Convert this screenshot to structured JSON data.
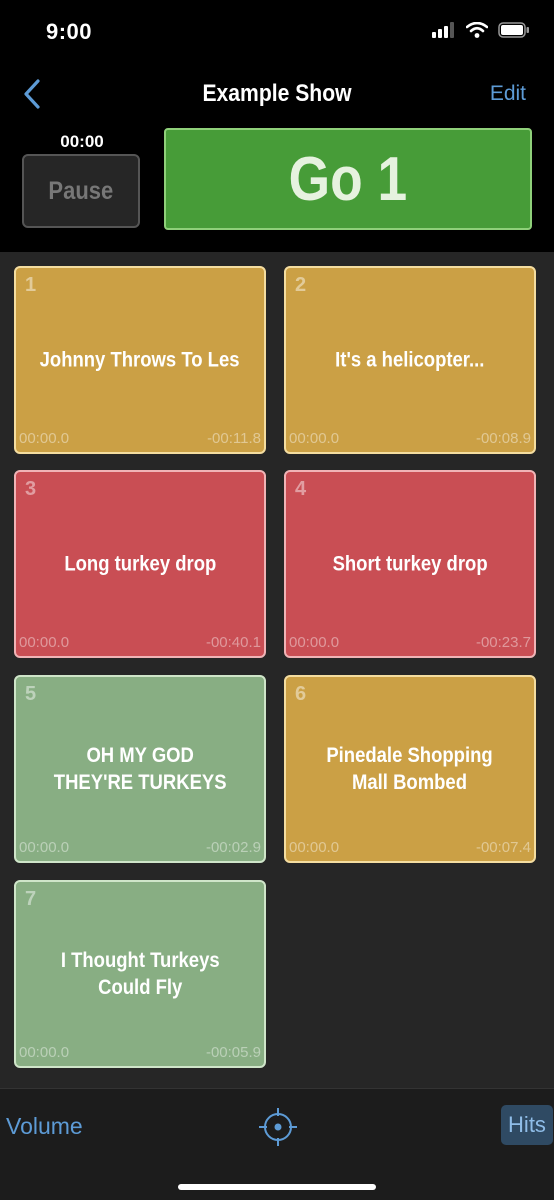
{
  "status_bar": {
    "time": "9:00",
    "icons": [
      "cellular-signal-icon",
      "wifi-icon",
      "battery-icon"
    ]
  },
  "nav": {
    "back_icon": "chevron-left-icon",
    "title": "Example Show",
    "edit_label": "Edit"
  },
  "controls": {
    "timer": "00:00",
    "pause_label": "Pause",
    "go_label": "Go 1"
  },
  "cues": [
    {
      "number": "1",
      "title": "Johnny Throws To Les",
      "elapsed": "00:00.0",
      "remaining": "-00:11.8",
      "color": "#cba045"
    },
    {
      "number": "2",
      "title": "It's a helicopter...",
      "elapsed": "00:00.0",
      "remaining": "-00:08.9",
      "color": "#cba045"
    },
    {
      "number": "3",
      "title": "Long turkey drop",
      "elapsed": "00:00.0",
      "remaining": "-00:40.1",
      "color": "#c94e54"
    },
    {
      "number": "4",
      "title": "Short turkey drop",
      "elapsed": "00:00.0",
      "remaining": "-00:23.7",
      "color": "#c94e54"
    },
    {
      "number": "5",
      "title": "OH MY GOD\nTHEY'RE TURKEYS",
      "elapsed": "00:00.0",
      "remaining": "-00:02.9",
      "color": "#88ae83"
    },
    {
      "number": "6",
      "title": "Pinedale Shopping\nMall Bombed",
      "elapsed": "00:00.0",
      "remaining": "-00:07.4",
      "color": "#cba045"
    },
    {
      "number": "7",
      "title": "I Thought Turkeys\nCould Fly",
      "elapsed": "00:00.0",
      "remaining": "-00:05.9",
      "color": "#88ae83"
    }
  ],
  "toolbar": {
    "volume_label": "Volume",
    "center_icon": "crosshair-target-icon",
    "hits_label": "Hits"
  },
  "colors": {
    "accent_blue": "#5d9bd6",
    "go_green": "#479c38",
    "cue_yellow": "#cba045",
    "cue_red": "#c94e54",
    "cue_green": "#88ae83"
  }
}
